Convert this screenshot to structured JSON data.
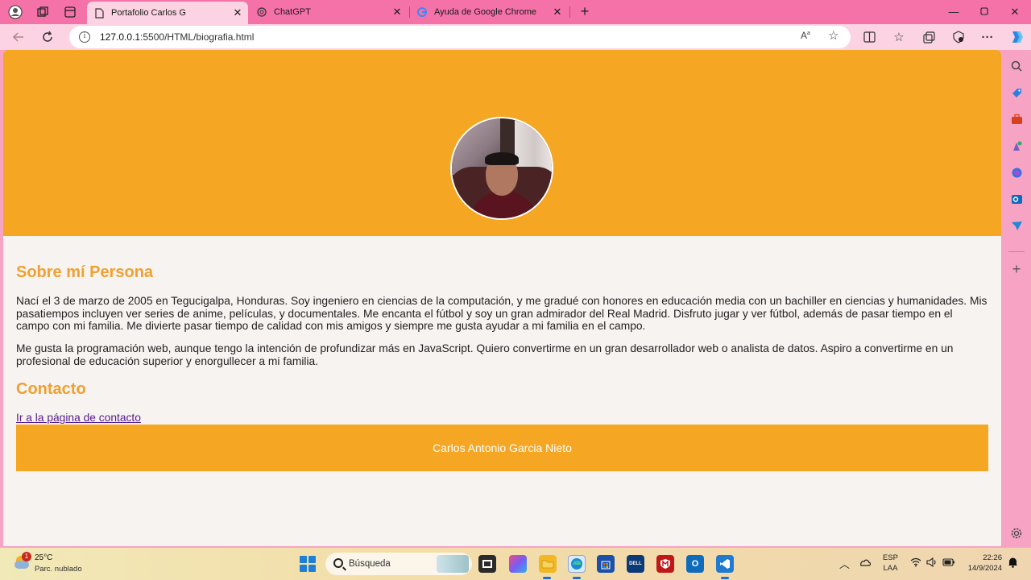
{
  "browser": {
    "tabs": [
      {
        "title": "Portafolio Carlos G",
        "active": true
      },
      {
        "title": "ChatGPT",
        "active": false
      },
      {
        "title": "Ayuda de Google Chrome",
        "active": false
      }
    ],
    "url_host": "127.0.0.1",
    "url_rest": ":5500/HTML/biografia.html"
  },
  "page": {
    "about_heading": "Sobre mí Persona",
    "about_paragraph_1": "Nací el 3 de marzo de 2005 en Tegucigalpa, Honduras. Soy ingeniero en ciencias de la computación, y me gradué con honores en educación media con un bachiller en ciencias y humanidades. Mis pasatiempos incluyen ver series de anime, películas, y documentales. Me encanta el fútbol y soy un gran admirador del Real Madrid. Disfruto jugar y ver fútbol, además de pasar tiempo en el campo con mi familia. Me divierte pasar tiempo de calidad con mis amigos y siempre me gusta ayudar a mi familia en el campo.",
    "about_paragraph_2": "Me gusta la programación web, aunque tengo la intención de profundizar más en JavaScript. Quiero convertirme en un gran desarrollador web o analista de datos. Aspiro a convertirme en un profesional de educación superior y enorgullecer a mi familia.",
    "contact_heading": "Contacto",
    "contact_link": "Ir a la página de contacto",
    "footer_name": "Carlos Antonio Garcia Nieto"
  },
  "taskbar": {
    "weather_badge": "1",
    "weather_temp": "25°C",
    "weather_desc": "Parc. nublado",
    "search_placeholder": "Búsqueda",
    "lang_line1": "ESP",
    "lang_line2": "LAA",
    "time": "22:26",
    "date": "14/9/2024"
  },
  "colors": {
    "accent": "#f5a623",
    "heading": "#f0a030",
    "browser_frame": "#f472a8"
  }
}
